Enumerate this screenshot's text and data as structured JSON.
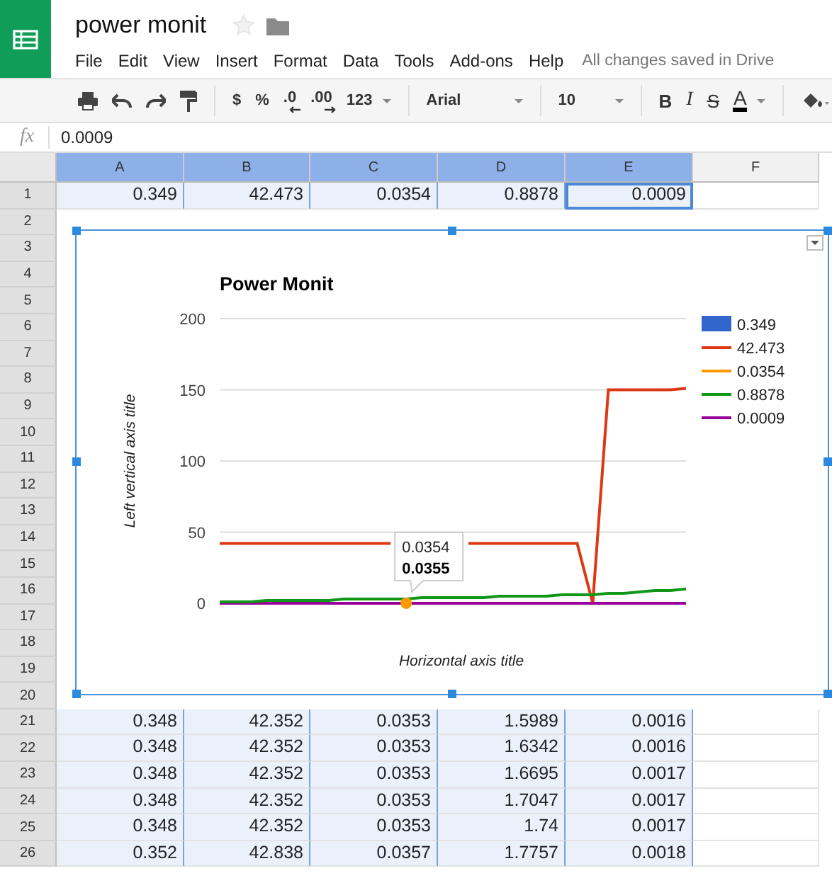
{
  "document": {
    "title": "power monit",
    "starred": false,
    "save_status": "All changes saved in Drive"
  },
  "menu": [
    "File",
    "Edit",
    "View",
    "Insert",
    "Format",
    "Data",
    "Tools",
    "Add-ons",
    "Help"
  ],
  "toolbar": {
    "currency": "$",
    "percent": "%",
    "decrease_decimals": ".0",
    "increase_decimals": ".00",
    "number_format": "123",
    "font": "Arial",
    "font_size": "10",
    "bold": "B",
    "italic": "I",
    "strikethrough": "S",
    "text_color": "A"
  },
  "formula_bar": {
    "label": "fx",
    "value": "0.0009"
  },
  "columns": [
    {
      "label": "A",
      "selected": true
    },
    {
      "label": "B",
      "selected": true
    },
    {
      "label": "C",
      "selected": true
    },
    {
      "label": "D",
      "selected": true
    },
    {
      "label": "E",
      "selected": true
    },
    {
      "label": "F",
      "selected": false
    }
  ],
  "rows": [
    {
      "label": "1",
      "cells": [
        {
          "text": "0.349",
          "active": false
        },
        {
          "text": "42.473",
          "active": false
        },
        {
          "text": "0.0354",
          "active": false
        },
        {
          "text": "0.8878",
          "active": false
        },
        {
          "text": "0.0009",
          "active": true
        }
      ]
    },
    {
      "label": "2"
    },
    {
      "label": "3"
    },
    {
      "label": "4"
    },
    {
      "label": "5"
    },
    {
      "label": "6"
    },
    {
      "label": "7"
    },
    {
      "label": "8"
    },
    {
      "label": "9"
    },
    {
      "label": "10"
    },
    {
      "label": "11"
    },
    {
      "label": "12"
    },
    {
      "label": "13"
    },
    {
      "label": "14"
    },
    {
      "label": "15"
    },
    {
      "label": "16"
    },
    {
      "label": "17"
    },
    {
      "label": "18"
    },
    {
      "label": "19"
    },
    {
      "label": "20"
    },
    {
      "label": "21",
      "cells": [
        {
          "text": "0.348",
          "active": false
        },
        {
          "text": "42.352",
          "active": false
        },
        {
          "text": "0.0353",
          "active": false
        },
        {
          "text": "1.5989",
          "active": false
        },
        {
          "text": "0.0016",
          "active": false
        }
      ]
    },
    {
      "label": "22",
      "cells": [
        {
          "text": "0.348",
          "active": false
        },
        {
          "text": "42.352",
          "active": false
        },
        {
          "text": "0.0353",
          "active": false
        },
        {
          "text": "1.6342",
          "active": false
        },
        {
          "text": "0.0016",
          "active": false
        }
      ]
    },
    {
      "label": "23",
      "cells": [
        {
          "text": "0.348",
          "active": false
        },
        {
          "text": "42.352",
          "active": false
        },
        {
          "text": "0.0353",
          "active": false
        },
        {
          "text": "1.6695",
          "active": false
        },
        {
          "text": "0.0017",
          "active": false
        }
      ]
    },
    {
      "label": "24",
      "cells": [
        {
          "text": "0.348",
          "active": false
        },
        {
          "text": "42.352",
          "active": false
        },
        {
          "text": "0.0353",
          "active": false
        },
        {
          "text": "1.7047",
          "active": false
        },
        {
          "text": "0.0017",
          "active": false
        }
      ]
    },
    {
      "label": "25",
      "cells": [
        {
          "text": "0.348",
          "active": false
        },
        {
          "text": "42.352",
          "active": false
        },
        {
          "text": "0.0353",
          "active": false
        },
        {
          "text": "1.74",
          "active": false
        },
        {
          "text": "0.0017",
          "active": false
        }
      ]
    },
    {
      "label": "26",
      "cells": [
        {
          "text": "0.352",
          "active": false
        },
        {
          "text": "42.838",
          "active": false
        },
        {
          "text": "0.0357",
          "active": false
        },
        {
          "text": "1.7757",
          "active": false
        },
        {
          "text": "0.0018",
          "active": false
        }
      ]
    }
  ],
  "chart": {
    "selected": true,
    "legend_entries": [
      {
        "kind": "box"
      },
      {
        "kind": "line"
      },
      {
        "kind": "line"
      },
      {
        "kind": "line"
      },
      {
        "kind": "line"
      }
    ],
    "tooltip": {
      "series": "0.0354",
      "value": "0.0355"
    },
    "chart_data": {
      "type": "line",
      "title": "Power Monit",
      "xlabel": "Horizontal axis title",
      "ylabel": "Left vertical axis title",
      "ylim": [
        0,
        200
      ],
      "yticks": [
        0,
        50,
        100,
        150,
        200
      ],
      "grid": true,
      "legend": true,
      "series": [
        {
          "name": "0.349",
          "color": "#3366cc",
          "values": [
            null,
            null,
            null,
            null,
            null,
            null,
            null,
            null,
            null,
            null,
            null,
            null,
            null,
            null,
            null,
            null,
            null,
            null,
            null,
            null,
            null,
            null,
            null,
            null,
            null,
            null,
            null,
            null,
            null,
            null,
            null
          ]
        },
        {
          "name": "42.473",
          "color": "#dc3912",
          "values": [
            42,
            42,
            42,
            42,
            42,
            42,
            42,
            42,
            42,
            42,
            42,
            42,
            null,
            null,
            null,
            null,
            42,
            42,
            42,
            42,
            42,
            42,
            42,
            42,
            0,
            150,
            150,
            150,
            150,
            150,
            151
          ]
        },
        {
          "name": "0.0354",
          "color": "#ff9900",
          "marker": "circle",
          "values": [
            null,
            null,
            null,
            null,
            null,
            null,
            null,
            null,
            null,
            null,
            null,
            null,
            0,
            null,
            null,
            null,
            null,
            null,
            null,
            null,
            null,
            null,
            null,
            null,
            null,
            null,
            null,
            null,
            null,
            null,
            null
          ]
        },
        {
          "name": "0.8878",
          "color": "#109618",
          "values": [
            1,
            1,
            1,
            2,
            2,
            2,
            2,
            2,
            3,
            3,
            3,
            3,
            3,
            4,
            4,
            4,
            4,
            4,
            5,
            5,
            5,
            5,
            6,
            6,
            6,
            7,
            7,
            8,
            9,
            9,
            10
          ]
        },
        {
          "name": "0.0009",
          "color": "#990099",
          "values": [
            0,
            0,
            0,
            0,
            0,
            0,
            0,
            0,
            0,
            0,
            0,
            0,
            0,
            0,
            0,
            0,
            0,
            0,
            0,
            0,
            0,
            0,
            0,
            0,
            0,
            0,
            0,
            0,
            0,
            0,
            0
          ]
        }
      ]
    }
  }
}
